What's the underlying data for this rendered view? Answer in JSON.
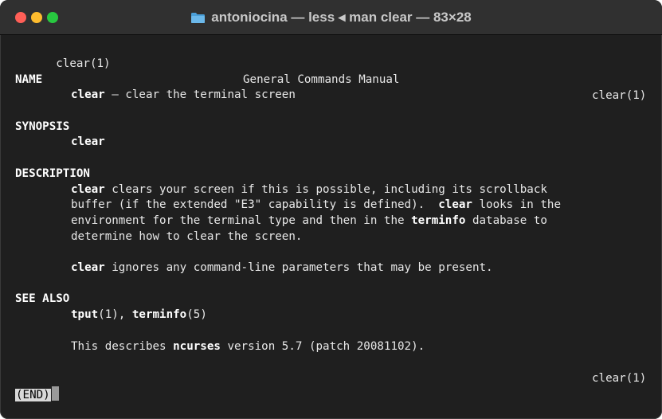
{
  "window": {
    "title": "antoniocina — less ◂ man clear — 83×28",
    "folder_icon": "folder-icon"
  },
  "man": {
    "header_left": "clear(1)",
    "header_center": "General Commands Manual",
    "header_right": "clear(1)",
    "name_heading": "NAME",
    "name_cmd": "clear",
    "name_desc": " – clear the terminal screen",
    "synopsis_heading": "SYNOPSIS",
    "synopsis_cmd": "clear",
    "description_heading": "DESCRIPTION",
    "desc_l1_cmd": "clear",
    "desc_l1_rest": " clears your screen if this is possible, including its scrollback",
    "desc_l2_a": "buffer (if the extended \"E3\" capability is defined).  ",
    "desc_l2_cmd": "clear",
    "desc_l2_b": " looks in the",
    "desc_l3_a": "environment for the terminal type and then in the ",
    "desc_l3_term": "terminfo",
    "desc_l3_b": " database to",
    "desc_l4": "determine how to clear the screen.",
    "desc_p2_cmd": "clear",
    "desc_p2_rest": " ignores any command-line parameters that may be present.",
    "see_also_heading": "SEE ALSO",
    "see_tput": "tput",
    "see_tput_sec": "(1), ",
    "see_terminfo": "terminfo",
    "see_terminfo_sec": "(5)",
    "ncurses_a": "This describes ",
    "ncurses_b": "ncurses",
    "ncurses_c": " version 5.7 (patch 20081102).",
    "footer_right": "clear(1)"
  },
  "prompt": {
    "end_label": "(END)"
  }
}
